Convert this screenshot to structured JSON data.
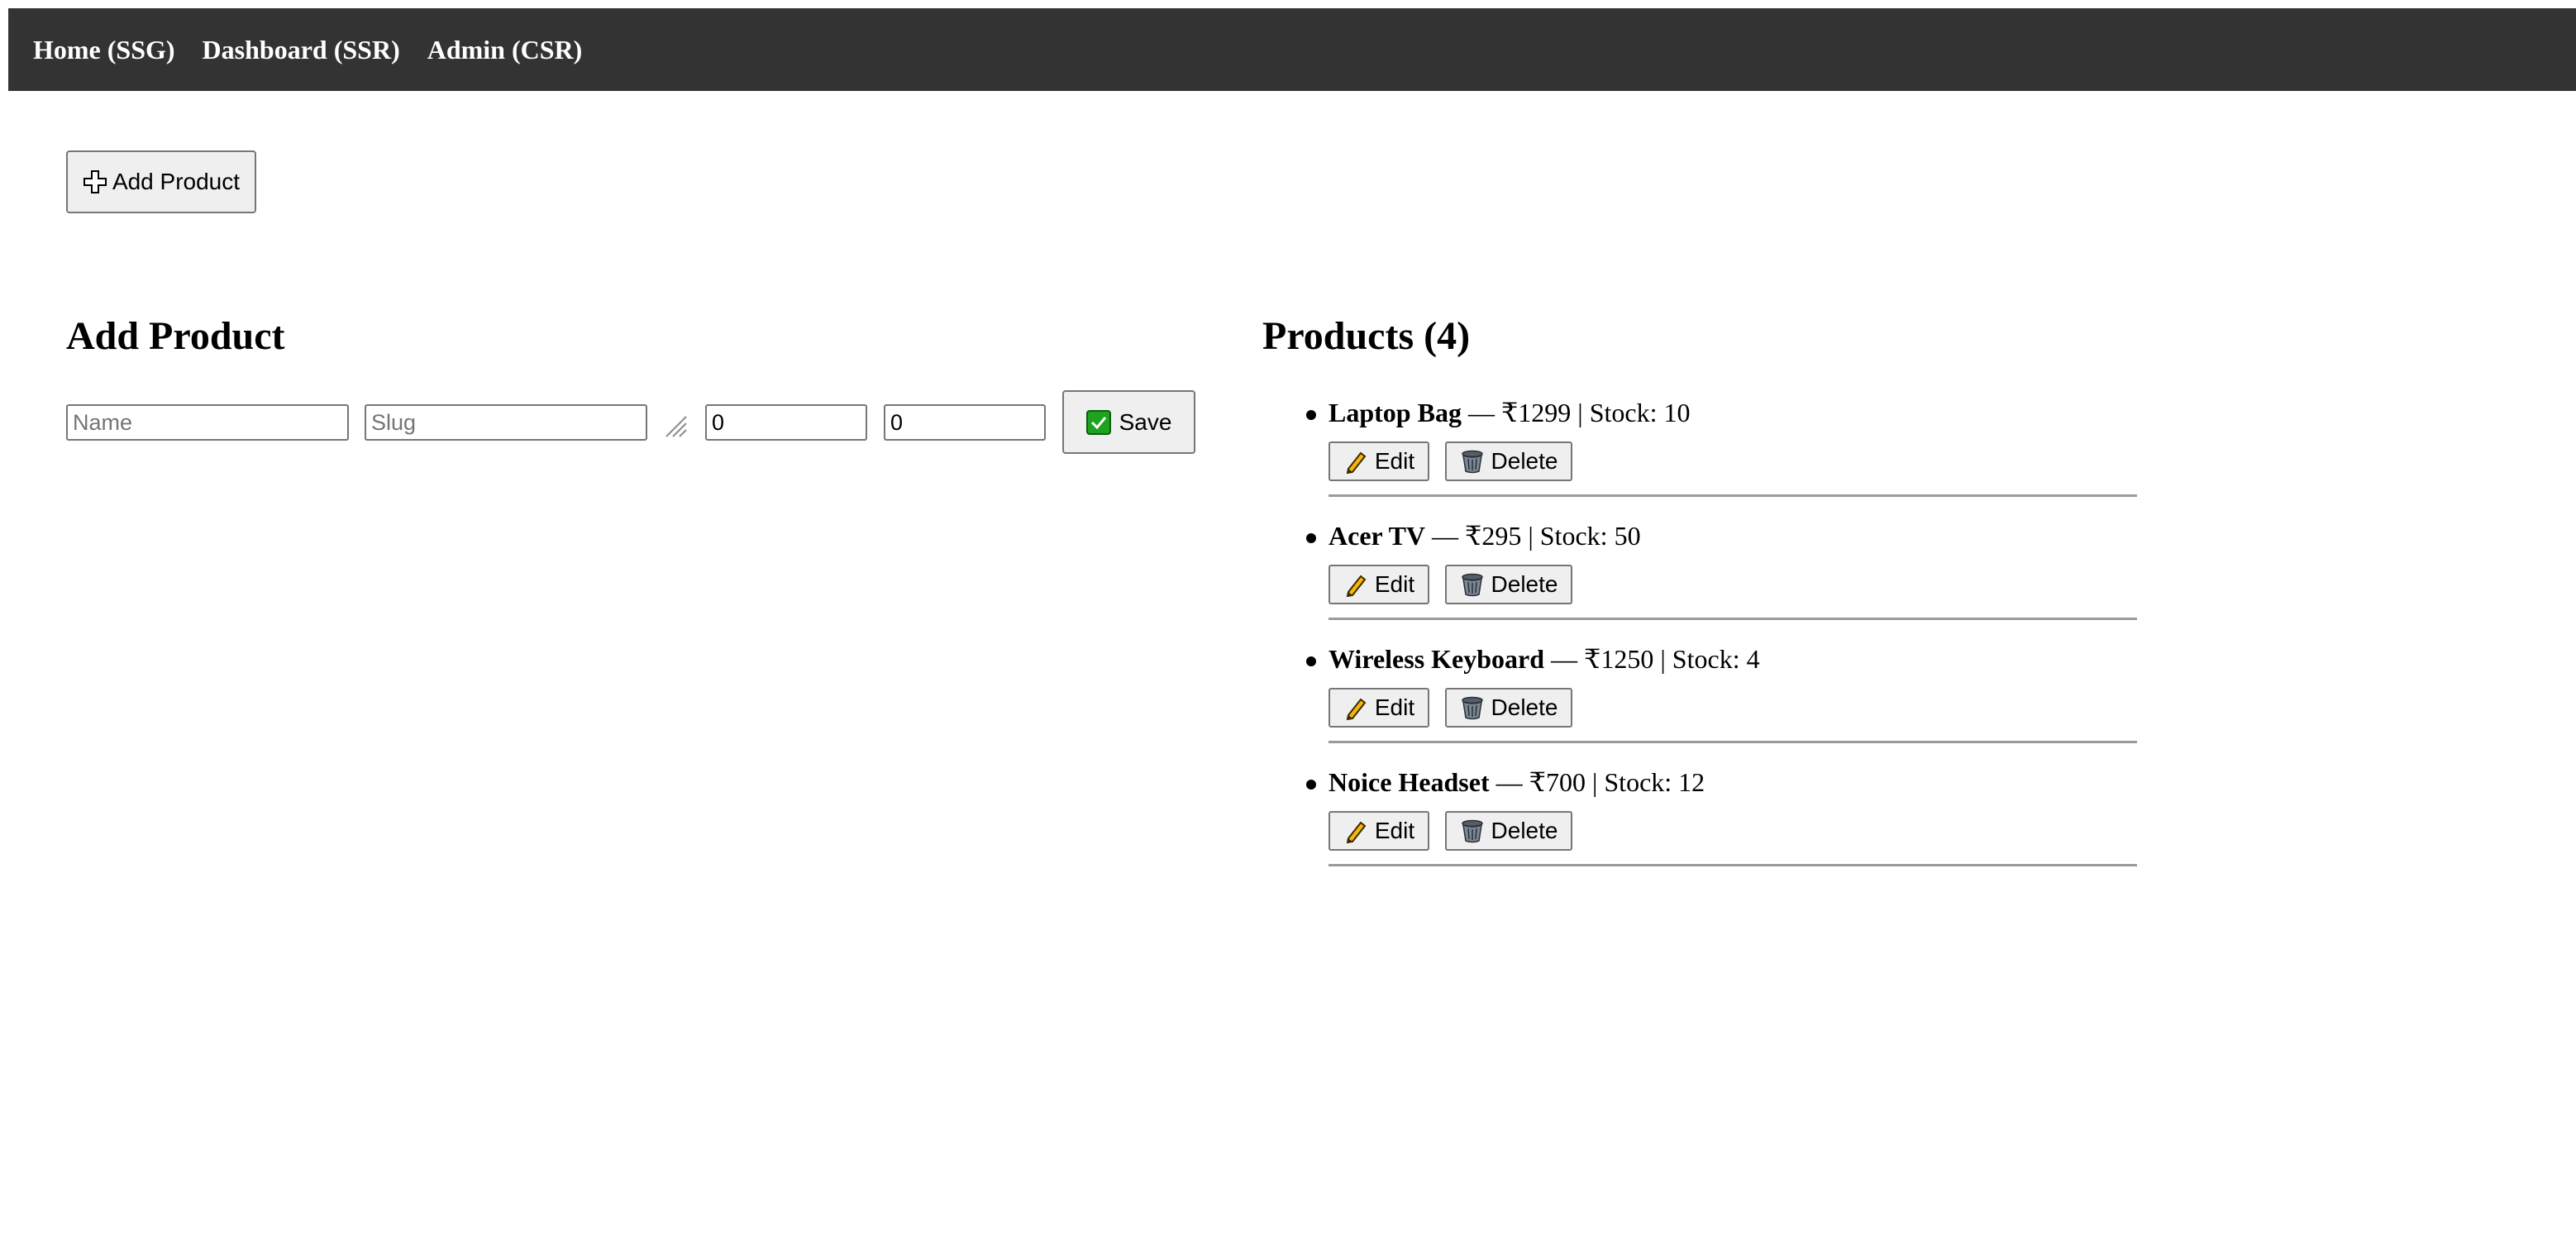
{
  "nav": {
    "links": [
      {
        "label": "Home (SSG)"
      },
      {
        "label": "Dashboard (SSR)"
      },
      {
        "label": "Admin (CSR)"
      }
    ]
  },
  "toolbar": {
    "add_product_label": "Add Product",
    "add_product_icon": "plus-icon"
  },
  "form": {
    "heading": "Add Product",
    "name_placeholder": "Name",
    "name_value": "",
    "slug_placeholder": "Slug",
    "slug_value": "",
    "price_value": "0",
    "stock_value": "0",
    "save_label": "Save",
    "save_icon": "checkmark-icon"
  },
  "products": {
    "heading": "Products (4)",
    "edit_label": "Edit",
    "delete_label": "Delete",
    "items": [
      {
        "name": "Laptop Bag",
        "details": " — ₹1299 | Stock: 10"
      },
      {
        "name": "Acer TV",
        "details": " — ₹295 | Stock: 50"
      },
      {
        "name": "Wireless Keyboard",
        "details": " — ₹1250 | Stock: 4"
      },
      {
        "name": "Noice Headset",
        "details": " — ₹700 | Stock: 12"
      }
    ]
  },
  "colors": {
    "nav_background": "#333333",
    "nav_text": "#ffffff",
    "button_background": "#efefef",
    "save_icon_green": "#1fa31f",
    "edit_icon_yellow": "#f5b50a"
  }
}
